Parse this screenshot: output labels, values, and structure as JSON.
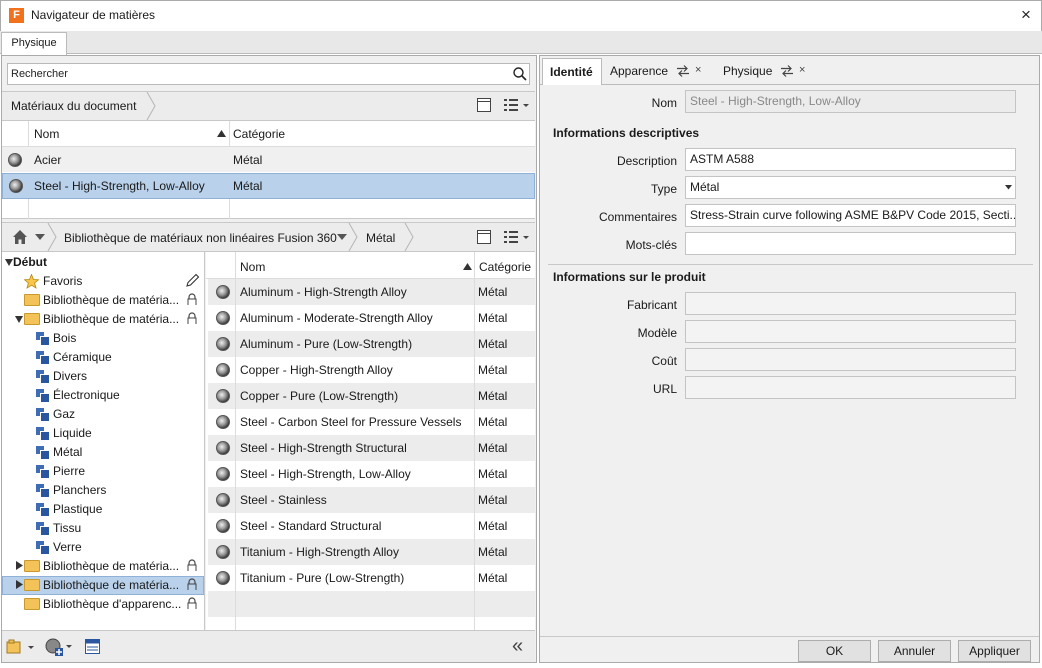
{
  "window": {
    "title": "Navigateur de matières",
    "logo_letter": "F",
    "close": "×"
  },
  "tabs": [
    "Physique"
  ],
  "search": {
    "placeholder": "Rechercher"
  },
  "document": {
    "breadcrumb": "Matériaux du document",
    "columns": {
      "name": "Nom",
      "category": "Catégorie"
    },
    "rows": [
      {
        "name": "Acier",
        "category": "Métal",
        "selected": false
      },
      {
        "name": "Steel - High-Strength, Low-Alloy",
        "category": "Métal",
        "selected": true
      }
    ]
  },
  "library": {
    "breadcrumb": [
      "Bibliothèque de matériaux non linéaires Fusion 360",
      "Métal"
    ],
    "tree": {
      "root": "Début",
      "favorites": "Favoris",
      "libs": [
        "Bibliothèque de matéria...",
        "Bibliothèque de matéria...",
        "Bibliothèque de matéria...",
        "Bibliothèque de matéria...",
        "Bibliothèque d'apparenc..."
      ],
      "categories": [
        "Bois",
        "Céramique",
        "Divers",
        "Électronique",
        "Gaz",
        "Liquide",
        "Métal",
        "Pierre",
        "Planchers",
        "Plastique",
        "Tissu",
        "Verre"
      ]
    },
    "columns": {
      "name": "Nom",
      "category": "Catégorie"
    },
    "rows": [
      {
        "name": "Aluminum - High-Strength Alloy",
        "category": "Métal"
      },
      {
        "name": "Aluminum - Moderate-Strength Alloy",
        "category": "Métal"
      },
      {
        "name": "Aluminum - Pure (Low-Strength)",
        "category": "Métal"
      },
      {
        "name": "Copper - High-Strength Alloy",
        "category": "Métal"
      },
      {
        "name": "Copper - Pure (Low-Strength)",
        "category": "Métal"
      },
      {
        "name": "Steel - Carbon Steel for Pressure Vessels",
        "category": "Métal"
      },
      {
        "name": "Steel - High-Strength Structural",
        "category": "Métal"
      },
      {
        "name": "Steel - High-Strength, Low-Alloy",
        "category": "Métal"
      },
      {
        "name": "Steel - Stainless",
        "category": "Métal"
      },
      {
        "name": "Steel - Standard Structural",
        "category": "Métal"
      },
      {
        "name": "Titanium - High-Strength Alloy",
        "category": "Métal"
      },
      {
        "name": "Titanium - Pure (Low-Strength)",
        "category": "Métal"
      }
    ],
    "collapse": "«"
  },
  "editor": {
    "tabs": [
      "Identité",
      "Apparence",
      "Physique"
    ],
    "name_label": "Nom",
    "name_value": "Steel - High-Strength, Low-Alloy",
    "descriptive_title": "Informations descriptives",
    "description_label": "Description",
    "description_value": "ASTM A588",
    "type_label": "Type",
    "type_value": "Métal",
    "comments_label": "Commentaires",
    "comments_value": "Stress-Strain curve following ASME B&PV Code 2015, Secti...",
    "keywords_label": "Mots-clés",
    "keywords_value": "",
    "product_title": "Informations sur le produit",
    "manufacturer_label": "Fabricant",
    "model_label": "Modèle",
    "cost_label": "Coût",
    "url_label": "URL"
  },
  "buttons": {
    "ok": "OK",
    "cancel": "Annuler",
    "apply": "Appliquer"
  },
  "colors": {
    "selection": "#b9d1ea",
    "accent_logo": "#f2711c",
    "category_icon": "#3e6db5"
  }
}
